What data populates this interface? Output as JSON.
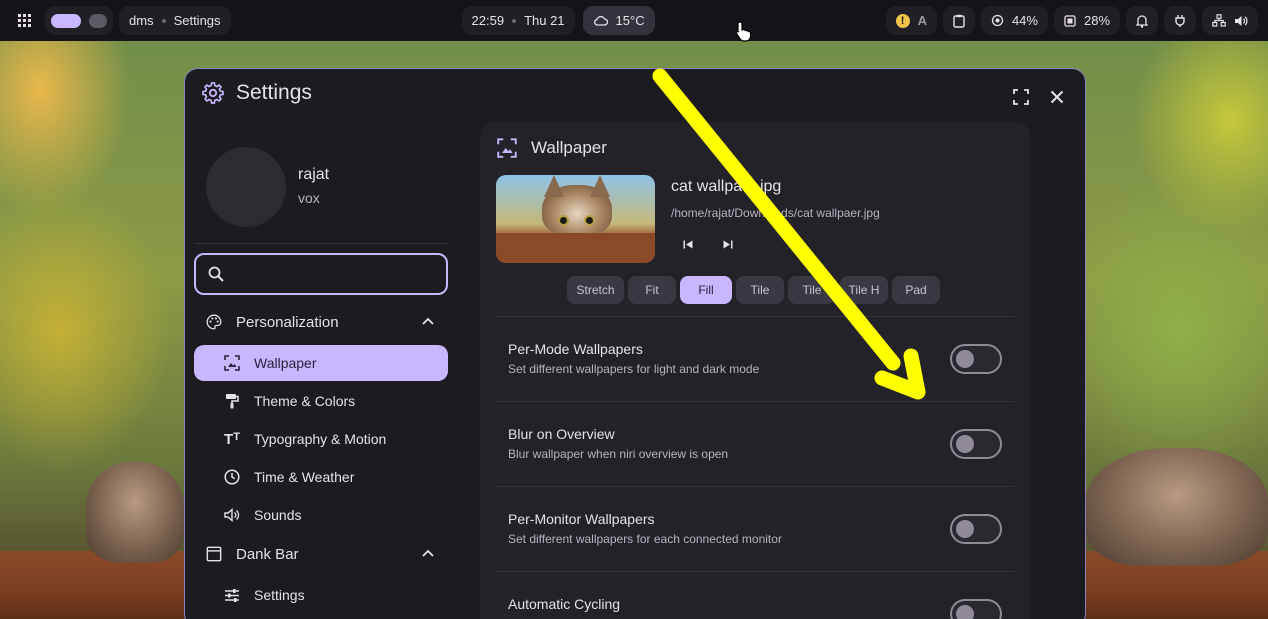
{
  "topbar": {
    "app": "dms",
    "page": "Settings",
    "time": "22:59",
    "date": "Thu 21",
    "weather": "15°C",
    "cpu": "44%",
    "ram": "28%"
  },
  "window": {
    "title": "Settings"
  },
  "user": {
    "name": "rajat",
    "subtitle": "vox"
  },
  "search": {
    "placeholder": ""
  },
  "sidebar": {
    "sections": [
      {
        "label": "Personalization"
      },
      {
        "label": "Dank Bar"
      }
    ],
    "items": [
      {
        "label": "Wallpaper"
      },
      {
        "label": "Theme & Colors"
      },
      {
        "label": "Typography & Motion"
      },
      {
        "label": "Time & Weather"
      },
      {
        "label": "Sounds"
      },
      {
        "label": "Settings"
      }
    ]
  },
  "wallpaper": {
    "heading": "Wallpaper",
    "file_name": "cat wallpaer.jpg",
    "file_path": "/home/rajat/Downloads/cat wallpaer.jpg",
    "modes": [
      "Stretch",
      "Fit",
      "Fill",
      "Tile",
      "Tile",
      "Tile H",
      "Pad"
    ],
    "selected_mode": "Fill"
  },
  "settings_rows": [
    {
      "title": "Per-Mode Wallpapers",
      "subtitle": "Set different wallpapers for light and dark mode",
      "enabled": false
    },
    {
      "title": "Blur on Overview",
      "subtitle": "Blur wallpaper when niri overview is open",
      "enabled": false
    },
    {
      "title": "Per-Monitor Wallpapers",
      "subtitle": "Set different wallpapers for each connected monitor",
      "enabled": false
    },
    {
      "title": "Automatic Cycling",
      "subtitle": "",
      "enabled": false
    }
  ],
  "colors": {
    "accent": "#c8b6ff",
    "annotation_arrow": "#ffff00"
  }
}
